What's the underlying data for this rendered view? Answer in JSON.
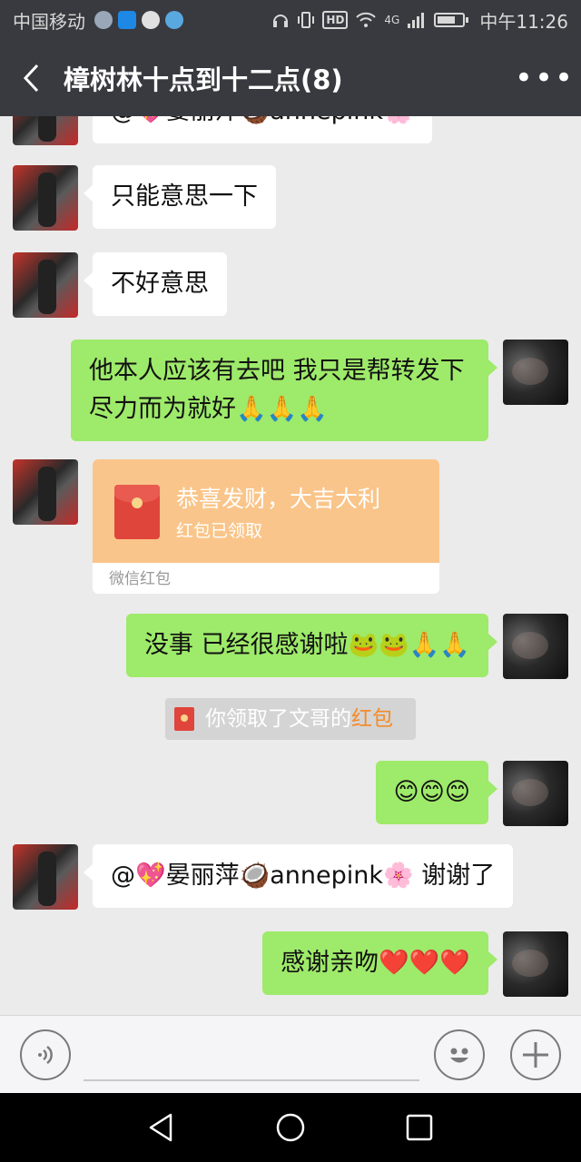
{
  "status_bar": {
    "carrier": "中国移动",
    "time": "中午11:26",
    "hd_label": "HD",
    "network_label": "4G",
    "battery_level": 0.7,
    "icons": [
      "weather-icon",
      "shield-icon",
      "chat-bubble-icon",
      "telegram-icon",
      "headset-icon",
      "vibrate-icon",
      "hd-icon",
      "wifi-icon",
      "signal-icon",
      "battery-icon"
    ]
  },
  "title_bar": {
    "title": "樟树林十点到十二点(8)",
    "back_icon": "chevron-left-icon",
    "more_icon": "more-icon"
  },
  "messages": [
    {
      "side": "in",
      "text": "只能意思一下"
    },
    {
      "side": "in",
      "text": "不好意思"
    },
    {
      "side": "out",
      "text": "他本人应该有去吧  我只是帮转发下尽力而为就好🙏🙏🙏"
    },
    {
      "side": "in",
      "type": "red_packet",
      "title": "恭喜发财，大吉大利",
      "status": "红包已领取",
      "footer": "微信红包"
    },
    {
      "side": "out",
      "text": "没事  已经很感谢啦🐸🐸🙏🙏"
    },
    {
      "side": "system",
      "prefix": "你领取了文哥的",
      "highlight": "红包"
    },
    {
      "side": "out",
      "text": "😊😊😊"
    },
    {
      "side": "in",
      "text": "@💖晏丽萍🥥annepink🌸  谢谢了"
    },
    {
      "side": "out",
      "text": "感谢亲吻❤️❤️❤️"
    }
  ],
  "partial_top_message": "@💖晏丽萍🥥annepink🌸",
  "input_bar": {
    "voice_icon": "voice-icon",
    "emoji_icon": "emoji-icon",
    "plus_icon": "plus-icon"
  },
  "nav_bar": {
    "icons": [
      "back-triangle-icon",
      "home-circle-icon",
      "recents-square-icon"
    ]
  },
  "colors": {
    "bar_bg": "#393a3f",
    "chat_bg": "#ebebeb",
    "bubble_out": "#9eea6a",
    "bubble_in": "#ffffff",
    "red_packet": "#fac58a",
    "highlight": "#f48b28"
  }
}
